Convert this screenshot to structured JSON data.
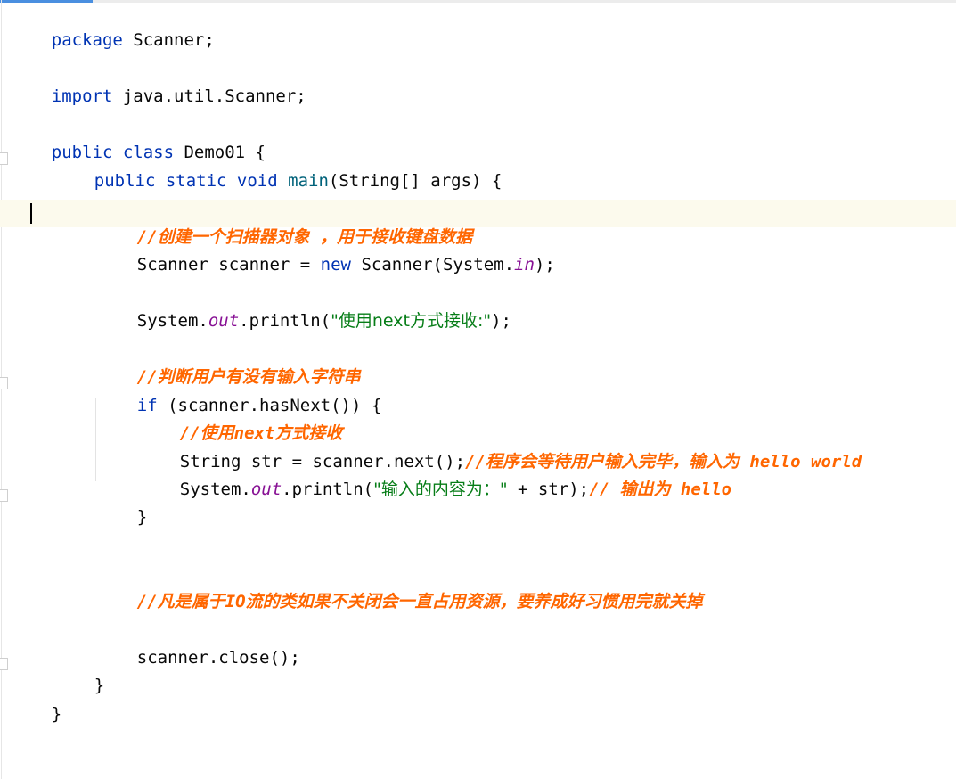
{
  "code": {
    "l1": {
      "kw": "package",
      "rest": " Scanner;"
    },
    "l2": {
      "kw": "import",
      "rest": " java.util.Scanner;"
    },
    "l3": {
      "kw1": "public",
      "kw2": " class",
      "rest": " Demo01 {"
    },
    "l4": {
      "kw": "public static void",
      "fn": "main",
      "rest": "(String[] args) {"
    },
    "l5": {
      "comment": "//创建一个扫描器对象 ，用于接收键盘数据"
    },
    "l6": {
      "pre": "Scanner scanner = ",
      "kw": "new",
      "mid": " Scanner(System.",
      "field": "in",
      "post": ");"
    },
    "l7": {
      "pre": "System.",
      "field": "out",
      "mid": ".println(",
      "str": "\"使用next方式接收:\"",
      "post": ");"
    },
    "l8": {
      "comment": "//判断用户有没有输入字符串"
    },
    "l9": {
      "kw": "if",
      "rest": " (scanner.hasNext()) {"
    },
    "l10": {
      "comment": "//使用next方式接收"
    },
    "l11": {
      "code": "String str = scanner.next();",
      "comment": "//程序会等待用户输入完毕，输入为 hello world"
    },
    "l12": {
      "pre": "System.",
      "field": "out",
      "mid": ".println(",
      "str": "\"输入的内容为：\"",
      "post": " + str);",
      "comment": "// 输出为 hello"
    },
    "l13": {
      "text": "}"
    },
    "l14": {
      "comment": "//凡是属于IO流的类如果不关闭会一直占用资源，要养成好习惯用完就关掉"
    },
    "l15": {
      "text": "scanner.close();"
    },
    "l16": {
      "text": "}"
    },
    "l17": {
      "text": "}"
    }
  },
  "colors": {
    "keyword": "#0033b3",
    "method": "#00627a",
    "static_field": "#871094",
    "string": "#067d17",
    "comment": "#ff6600",
    "caret_line": "#fcfaed",
    "tab_accent": "#4a8fe0"
  },
  "icons": {
    "fold_marker": "fold-marker-icon",
    "text_caret": "text-caret"
  }
}
